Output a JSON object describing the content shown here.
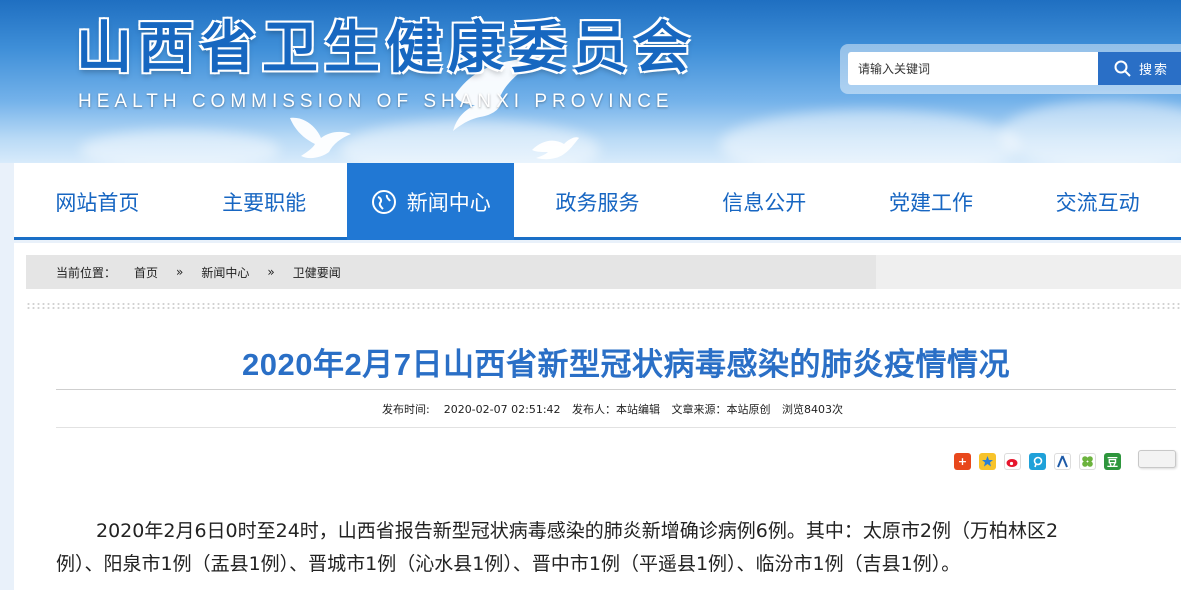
{
  "header": {
    "title": "山西省卫生健康委员会",
    "subtitle": "HEALTH COMMISSION OF SHANXI PROVINCE",
    "search_placeholder": "请输入关键词",
    "search_button": "搜索"
  },
  "nav": {
    "items": [
      {
        "label": "网站首页"
      },
      {
        "label": "主要职能"
      },
      {
        "label": "新闻中心"
      },
      {
        "label": "政务服务"
      },
      {
        "label": "信息公开"
      },
      {
        "label": "党建工作"
      },
      {
        "label": "交流互动"
      }
    ],
    "active_index": 2
  },
  "breadcrumb": {
    "prefix": "当前位置：",
    "items": [
      "首页",
      "新闻中心",
      "卫健要闻"
    ],
    "separator": "»"
  },
  "article": {
    "title": "2020年2月7日山西省新型冠状病毒感染的肺炎疫情情况",
    "meta": {
      "publish_time": "发布时间:    2020-02-07 02:51:42",
      "publisher": "发布人：本站编辑",
      "source": "文章来源：本站原创",
      "views": "浏览8403次"
    },
    "body_line1": "2020年2月6日0时至24时，山西省报告新型冠状病毒感染的肺炎新增确诊病例6例。其中：太原市2例（万柏林区2",
    "body_line2": "例）、阳泉市1例（盂县1例）、晋城市1例（沁水县1例）、晋中市1例（平遥县1例）、临汾市1例（吉县1例）。"
  },
  "share": {
    "icons": [
      "plus-share",
      "qzone",
      "weibo",
      "tencent-weibo",
      "renren",
      "kaixin",
      "douban"
    ],
    "douban_label": "豆"
  },
  "colors": {
    "brand_blue": "#1767c0",
    "nav_active": "#2178d4",
    "title_blue": "#2a6fc6"
  }
}
